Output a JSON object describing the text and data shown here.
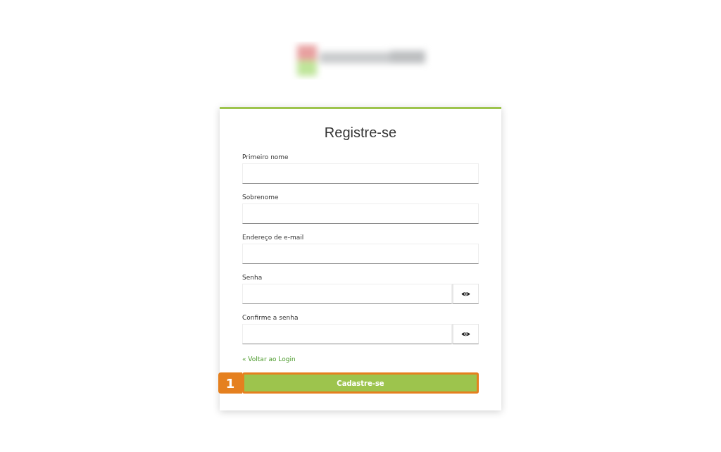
{
  "card": {
    "title": "Registre-se",
    "fields": [
      {
        "label": "Primeiro nome",
        "kind": "text"
      },
      {
        "label": "Sobrenome",
        "kind": "text"
      },
      {
        "label": "Endereço de e-mail",
        "kind": "text"
      },
      {
        "label": "Senha",
        "kind": "password"
      },
      {
        "label": "Confirme a senha",
        "kind": "password"
      }
    ],
    "back_link": "« Voltar ao Login",
    "submit_button": {
      "label": "Cadastre-se",
      "highlighted": true
    },
    "callout": "1"
  }
}
